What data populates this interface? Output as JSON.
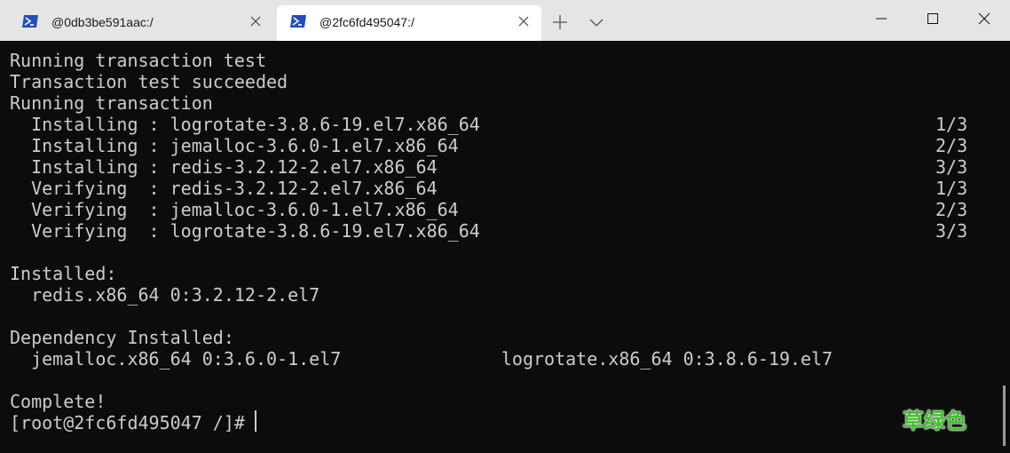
{
  "tabs": [
    {
      "title": "@0db3be591aac:/",
      "active": false
    },
    {
      "title": "@2fc6fd495047:/",
      "active": true
    }
  ],
  "icons": {
    "tab_icon": "powershell-terminal-icon",
    "close": "close-icon",
    "new_tab": "plus-icon",
    "dropdown": "chevron-down-icon",
    "minimize": "minimize-icon",
    "maximize": "maximize-icon",
    "window_close": "window-close-icon"
  },
  "colors": {
    "terminal_bg": "#0c0c0c",
    "terminal_fg": "#cccccc",
    "titlebar_bg": "#e5e5e5",
    "active_tab_bg": "#ffffff",
    "tab_icon": "#1f4fbf",
    "watermark": "#3fbf2a"
  },
  "terminal": {
    "lines": [
      "Running transaction test",
      "Transaction test succeeded",
      "Running transaction",
      "  Installing : logrotate-3.8.6-19.el7.x86_64",
      "  Installing : jemalloc-3.6.0-1.el7.x86_64",
      "  Installing : redis-3.2.12-2.el7.x86_64",
      "  Verifying  : redis-3.2.12-2.el7.x86_64",
      "  Verifying  : jemalloc-3.6.0-1.el7.x86_64",
      "  Verifying  : logrotate-3.8.6-19.el7.x86_64",
      "",
      "Installed:",
      "  redis.x86_64 0:3.2.12-2.el7",
      "",
      "Dependency Installed:",
      "  jemalloc.x86_64 0:3.6.0-1.el7               logrotate.x86_64 0:3.8.6-19.el7",
      "",
      "Complete!",
      "[root@2fc6fd495047 /]# "
    ],
    "progress": [
      "",
      "",
      "",
      "1/3",
      "2/3",
      "3/3",
      "1/3",
      "2/3",
      "3/3",
      "",
      "",
      "",
      "",
      "",
      "",
      "",
      "",
      ""
    ]
  },
  "watermark": "草绿色"
}
